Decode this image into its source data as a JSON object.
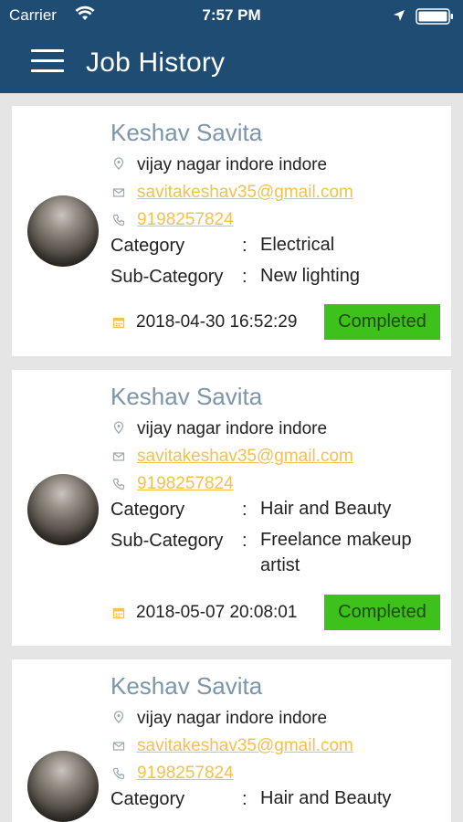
{
  "status_bar": {
    "carrier": "Carrier",
    "time": "7:57 PM"
  },
  "header": {
    "title": "Job History"
  },
  "labels": {
    "category": "Category",
    "sub_category": "Sub-Category",
    "separator": ":"
  },
  "jobs": [
    {
      "name": "Keshav Savita",
      "address": "vijay nagar indore indore",
      "email": "savitakeshav35@gmail.com",
      "phone": "9198257824",
      "category": "Electrical",
      "sub_category": "New lighting",
      "datetime": "2018-04-30 16:52:29",
      "status": "Completed"
    },
    {
      "name": "Keshav Savita",
      "address": "vijay nagar indore indore",
      "email": "savitakeshav35@gmail.com",
      "phone": "9198257824",
      "category": "Hair and Beauty",
      "sub_category": "Freelance makeup artist",
      "datetime": "2018-05-07 20:08:01",
      "status": "Completed"
    },
    {
      "name": "Keshav Savita",
      "address": "vijay nagar indore indore",
      "email": "savitakeshav35@gmail.com",
      "phone": "9198257824",
      "category": "Hair and Beauty"
    }
  ],
  "icons": {
    "menu": "hamburger-menu-icon",
    "location": "location-pin-icon",
    "email": "envelope-icon",
    "phone": "phone-icon",
    "date": "calendar-icon",
    "wifi": "wifi-icon",
    "gps": "location-arrow-icon",
    "battery": "battery-icon"
  },
  "colors": {
    "header_bg": "#1f4c72",
    "name": "#7b95a9",
    "link": "#f2c14e",
    "status_completed": "#3ec11b",
    "page_bg": "#e5e5e5"
  }
}
